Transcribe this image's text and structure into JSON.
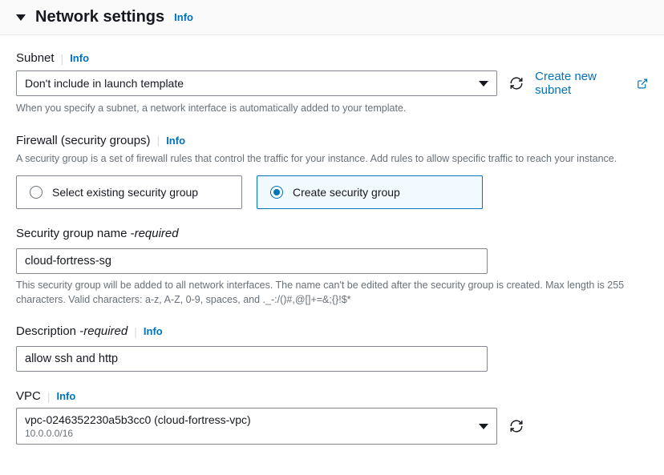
{
  "header": {
    "title": "Network settings",
    "info": "Info"
  },
  "subnet": {
    "label": "Subnet",
    "info": "Info",
    "value": "Don't include in launch template",
    "hint": "When you specify a subnet, a network interface is automatically added to your template.",
    "create_link": "Create new subnet"
  },
  "firewall": {
    "label": "Firewall (security groups)",
    "info": "Info",
    "hint": "A security group is a set of firewall rules that control the traffic for your instance. Add rules to allow specific traffic to reach your instance.",
    "options": {
      "existing": "Select existing security group",
      "create": "Create security group"
    }
  },
  "sg_name": {
    "label": "Security group name - ",
    "required": "required",
    "value": "cloud-fortress-sg",
    "hint": "This security group will be added to all network interfaces. The name can't be edited after the security group is created. Max length is 255 characters. Valid characters: a-z, A-Z, 0-9, spaces, and ._-:/()#,@[]+=&;{}!$*"
  },
  "description": {
    "label": "Description - ",
    "required": "required",
    "info": "Info",
    "value": "allow ssh and http"
  },
  "vpc": {
    "label": "VPC",
    "info": "Info",
    "value": "vpc-0246352230a5b3cc0 (cloud-fortress-vpc)",
    "cidr": "10.0.0.0/16"
  }
}
